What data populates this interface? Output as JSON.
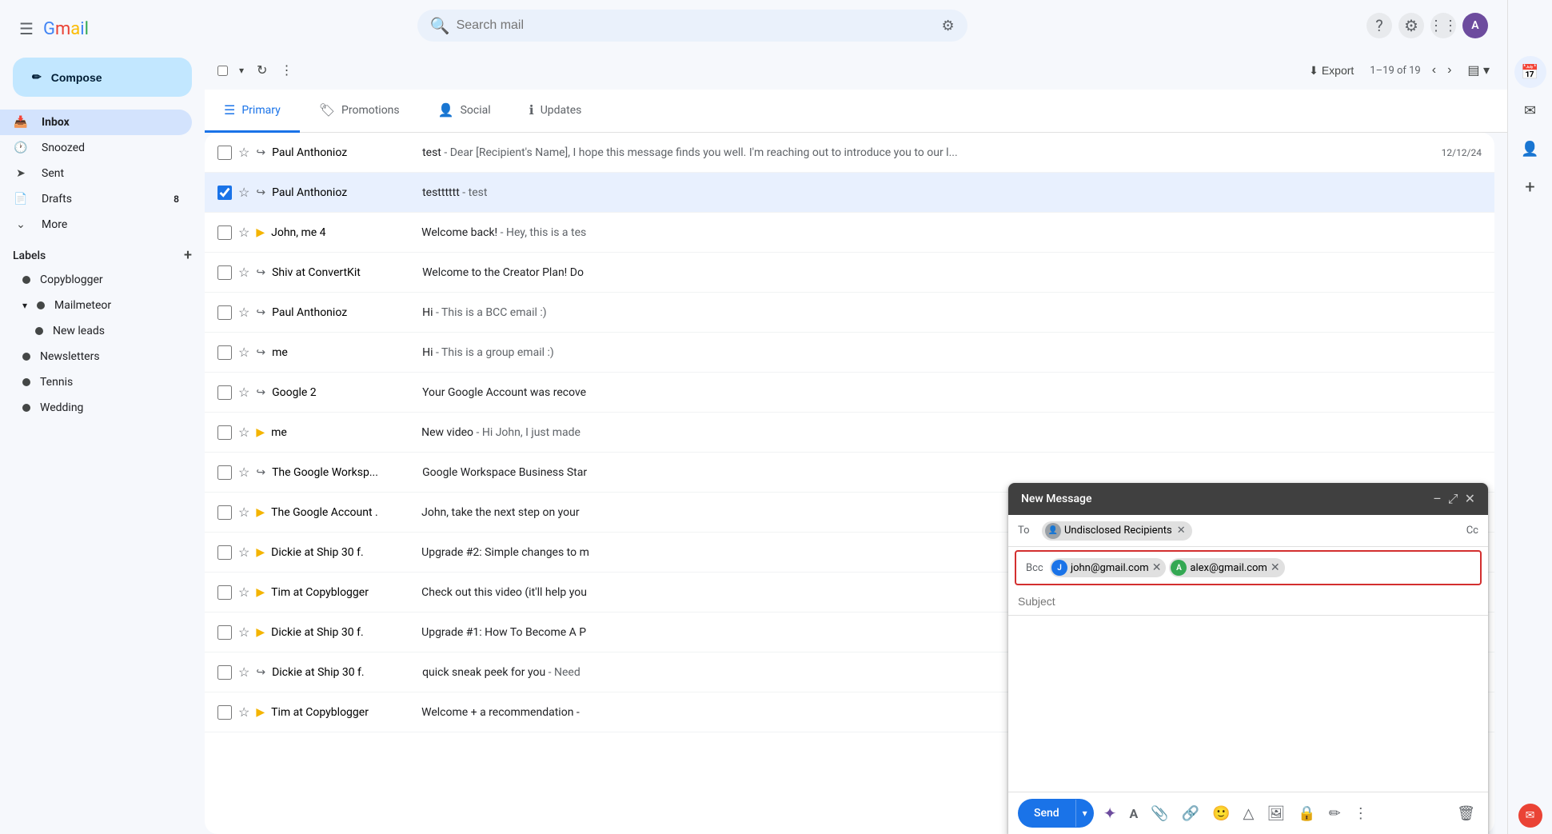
{
  "header": {
    "hamburger_label": "☰",
    "logo_parts": [
      "G",
      "m",
      "a",
      "i",
      "l"
    ],
    "search_placeholder": "Search mail",
    "filter_icon": "⚙",
    "help_icon": "?",
    "settings_icon": "⚙",
    "apps_icon": "⋮⋮⋮",
    "avatar_initials": "A"
  },
  "sidebar": {
    "compose_label": "Compose",
    "nav_items": [
      {
        "id": "inbox",
        "label": "Inbox",
        "icon": "📥",
        "badge": "",
        "active": true
      },
      {
        "id": "snoozed",
        "label": "Snoozed",
        "icon": "🕐",
        "badge": ""
      },
      {
        "id": "sent",
        "label": "Sent",
        "icon": "➤",
        "badge": ""
      },
      {
        "id": "drafts",
        "label": "Drafts",
        "icon": "📄",
        "badge": "8"
      },
      {
        "id": "more",
        "label": "More",
        "icon": "⌄",
        "badge": ""
      }
    ],
    "labels_header": "Labels",
    "labels": [
      {
        "id": "copyblogger",
        "label": "Copyblogger",
        "color": "#444746",
        "indent": 0
      },
      {
        "id": "mailmeteor",
        "label": "Mailmeteor",
        "color": "#444746",
        "indent": 0,
        "expanded": true
      },
      {
        "id": "new-leads",
        "label": "New leads",
        "color": "#444746",
        "indent": 1
      },
      {
        "id": "newsletters",
        "label": "Newsletters",
        "color": "#444746",
        "indent": 0
      },
      {
        "id": "tennis",
        "label": "Tennis",
        "color": "#444746",
        "indent": 0
      },
      {
        "id": "wedding",
        "label": "Wedding",
        "color": "#444746",
        "indent": 0
      }
    ]
  },
  "toolbar": {
    "export_label": "Export",
    "count": "1–19 of 19",
    "select_all": false
  },
  "tabs": [
    {
      "id": "primary",
      "label": "Primary",
      "icon": "☰",
      "active": true
    },
    {
      "id": "promotions",
      "label": "Promotions",
      "icon": "🏷",
      "active": false
    },
    {
      "id": "social",
      "label": "Social",
      "icon": "👤",
      "active": false
    },
    {
      "id": "updates",
      "label": "Updates",
      "icon": "ℹ",
      "active": false
    }
  ],
  "emails": [
    {
      "sender": "Paul Anthonioz",
      "subject": "test",
      "preview": "Dear [Recipient's Name], I hope this message finds you well. I'm reaching out to introduce you to our l...",
      "date": "12/12/24",
      "unread": false,
      "star": false,
      "important": false
    },
    {
      "sender": "Paul Anthonioz",
      "subject": "testttttt",
      "preview": "test",
      "date": "",
      "unread": false,
      "star": false,
      "important": false,
      "selected": true
    },
    {
      "sender": "John, me 4",
      "subject": "Welcome back!",
      "preview": "Hey, this is a tes",
      "date": "",
      "unread": false,
      "star": false,
      "important": true
    },
    {
      "sender": "Shiv at ConvertKit",
      "subject": "Welcome to the Creator Plan! Do",
      "preview": "",
      "date": "",
      "unread": false,
      "star": false,
      "important": false
    },
    {
      "sender": "Paul Anthonioz",
      "subject": "Hi",
      "preview": "This is a BCC email :)",
      "date": "",
      "unread": false,
      "star": false,
      "important": false
    },
    {
      "sender": "me",
      "subject": "Hi",
      "preview": "This is a group email :)",
      "date": "",
      "unread": false,
      "star": false,
      "important": false
    },
    {
      "sender": "Google 2",
      "subject": "Your Google Account was recove",
      "preview": "",
      "date": "",
      "unread": false,
      "star": false,
      "important": false
    },
    {
      "sender": "me",
      "subject": "New video",
      "preview": "Hi John, I just made",
      "date": "",
      "unread": false,
      "star": false,
      "important": true
    },
    {
      "sender": "The Google Worksp...",
      "subject": "Google Workspace Business Star",
      "preview": "",
      "date": "",
      "unread": false,
      "star": false,
      "important": false
    },
    {
      "sender": "The Google Account .",
      "subject": "John, take the next step on your",
      "preview": "",
      "date": "",
      "unread": false,
      "star": false,
      "important": true
    },
    {
      "sender": "Dickie at Ship 30 f.",
      "subject": "Upgrade #2: Simple changes to m",
      "preview": "",
      "date": "",
      "unread": false,
      "star": false,
      "important": true
    },
    {
      "sender": "Tim at Copyblogger",
      "subject": "Check out this video (it'll help you",
      "preview": "",
      "date": "",
      "unread": false,
      "star": false,
      "important": true
    },
    {
      "sender": "Dickie at Ship 30 f.",
      "subject": "Upgrade #1: How To Become A P",
      "preview": "",
      "date": "",
      "unread": false,
      "star": false,
      "important": true
    },
    {
      "sender": "Dickie at Ship 30 f.",
      "subject": "quick sneak peek for you",
      "preview": "Need",
      "date": "",
      "unread": false,
      "star": false,
      "important": false
    },
    {
      "sender": "Tim at Copyblogger",
      "subject": "Welcome + a recommendation -",
      "preview": "",
      "date": "",
      "unread": false,
      "star": false,
      "important": true
    }
  ],
  "compose": {
    "title": "New Message",
    "to_label": "To",
    "bcc_label": "Bcc",
    "cc_label": "Cc",
    "to_chip": "Undisclosed Recipients",
    "bcc_recipients": [
      {
        "email": "john@gmail.com",
        "initial": "J",
        "color": "blue"
      },
      {
        "email": "alex@gmail.com",
        "initial": "A",
        "color": "green"
      }
    ],
    "subject_placeholder": "Subject",
    "send_label": "Send",
    "minimize": "–",
    "expand": "⤢",
    "close": "✕"
  },
  "right_panel": {
    "icons": [
      "📅",
      "✉",
      "👤",
      "+"
    ]
  }
}
